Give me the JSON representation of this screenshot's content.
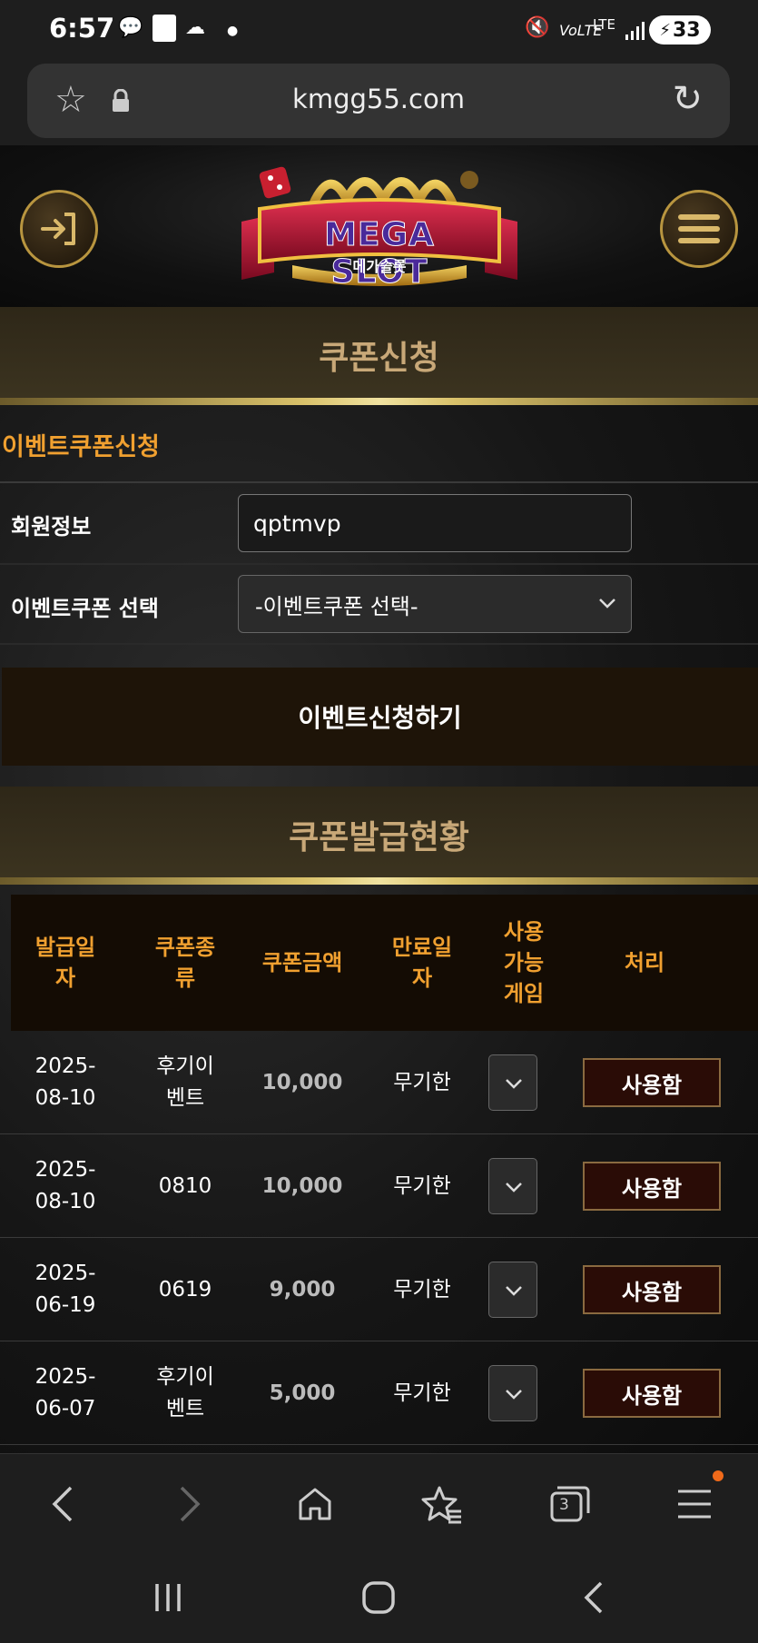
{
  "status_bar": {
    "time": "6:57",
    "battery": "33",
    "network": "LTE"
  },
  "browser": {
    "url": "kmgg55.com",
    "tab_count": "3"
  },
  "header": {
    "logo_text": "MEGA SLOT",
    "logo_subtext": "메가슬롯"
  },
  "coupon_apply": {
    "section_title": "쿠폰신청",
    "subtitle": "이벤트쿠폰신청",
    "member_label": "회원정보",
    "member_value": "qptmvp",
    "coupon_select_label": "이벤트쿠폰 선택",
    "coupon_select_value": "-이벤트쿠폰 선택-",
    "apply_button": "이벤트신청하기"
  },
  "coupon_status": {
    "section_title": "쿠폰발급현황",
    "columns": [
      "발급일자",
      "쿠폰종류",
      "쿠폰금액",
      "만료일자",
      "사용가능게임",
      "처리"
    ],
    "rows": [
      {
        "date": "2025-08-10",
        "type": "후기이벤트",
        "amount": "10,000",
        "expiry": "무기한",
        "action": "사용함"
      },
      {
        "date": "2025-08-10",
        "type": "0810",
        "amount": "10,000",
        "expiry": "무기한",
        "action": "사용함"
      },
      {
        "date": "2025-06-19",
        "type": "0619",
        "amount": "9,000",
        "expiry": "무기한",
        "action": "사용함"
      },
      {
        "date": "2025-06-07",
        "type": "후기이벤트",
        "amount": "5,000",
        "expiry": "무기한",
        "action": "사용함"
      }
    ]
  },
  "colors": {
    "accent_orange": "#f0a030",
    "gold": "#c8a878",
    "button_dark": "#2a0c06"
  }
}
